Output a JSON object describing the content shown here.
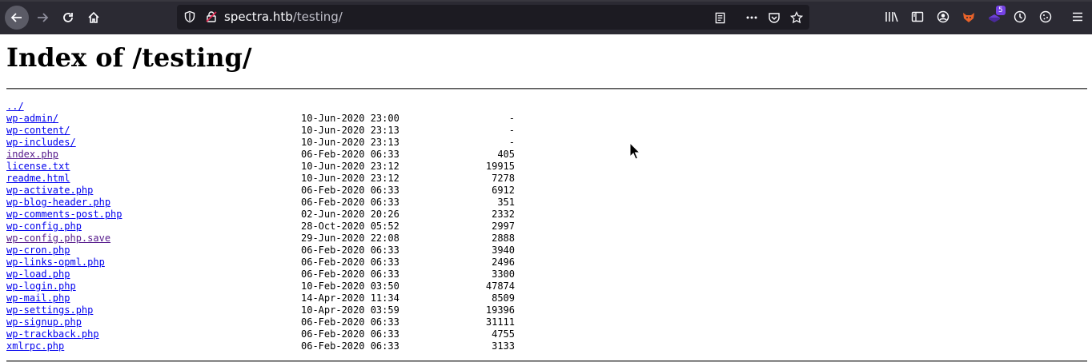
{
  "browser": {
    "url_host": "spectra.htb",
    "url_path": "/testing/",
    "extension_badge": "5"
  },
  "page": {
    "title": "Index of /testing/",
    "entries": [
      {
        "name": "../",
        "date": "",
        "size": "",
        "visited": false
      },
      {
        "name": "wp-admin/",
        "date": "10-Jun-2020 23:00",
        "size": "-",
        "visited": false
      },
      {
        "name": "wp-content/",
        "date": "10-Jun-2020 23:13",
        "size": "-",
        "visited": false
      },
      {
        "name": "wp-includes/",
        "date": "10-Jun-2020 23:13",
        "size": "-",
        "visited": false
      },
      {
        "name": "index.php",
        "date": "06-Feb-2020 06:33",
        "size": "405",
        "visited": true
      },
      {
        "name": "license.txt",
        "date": "10-Jun-2020 23:12",
        "size": "19915",
        "visited": false
      },
      {
        "name": "readme.html",
        "date": "10-Jun-2020 23:12",
        "size": "7278",
        "visited": false
      },
      {
        "name": "wp-activate.php",
        "date": "06-Feb-2020 06:33",
        "size": "6912",
        "visited": false
      },
      {
        "name": "wp-blog-header.php",
        "date": "06-Feb-2020 06:33",
        "size": "351",
        "visited": false
      },
      {
        "name": "wp-comments-post.php",
        "date": "02-Jun-2020 20:26",
        "size": "2332",
        "visited": false
      },
      {
        "name": "wp-config.php",
        "date": "28-Oct-2020 05:52",
        "size": "2997",
        "visited": false
      },
      {
        "name": "wp-config.php.save",
        "date": "29-Jun-2020 22:08",
        "size": "2888",
        "visited": true
      },
      {
        "name": "wp-cron.php",
        "date": "06-Feb-2020 06:33",
        "size": "3940",
        "visited": false
      },
      {
        "name": "wp-links-opml.php",
        "date": "06-Feb-2020 06:33",
        "size": "2496",
        "visited": false
      },
      {
        "name": "wp-load.php",
        "date": "06-Feb-2020 06:33",
        "size": "3300",
        "visited": false
      },
      {
        "name": "wp-login.php",
        "date": "10-Feb-2020 03:50",
        "size": "47874",
        "visited": false
      },
      {
        "name": "wp-mail.php",
        "date": "14-Apr-2020 11:34",
        "size": "8509",
        "visited": false
      },
      {
        "name": "wp-settings.php",
        "date": "10-Apr-2020 03:59",
        "size": "19396",
        "visited": false
      },
      {
        "name": "wp-signup.php",
        "date": "06-Feb-2020 06:33",
        "size": "31111",
        "visited": false
      },
      {
        "name": "wp-trackback.php",
        "date": "06-Feb-2020 06:33",
        "size": "4755",
        "visited": false
      },
      {
        "name": "xmlrpc.php",
        "date": "06-Feb-2020 06:33",
        "size": "3133",
        "visited": false
      }
    ]
  },
  "icons": [
    "back-icon",
    "forward-icon",
    "reload-icon",
    "home-icon",
    "shield-icon",
    "insecure-lock-icon",
    "reader-view-icon",
    "more-icon",
    "pocket-icon",
    "bookmark-star-icon",
    "library-icon",
    "sidebar-icon",
    "account-icon",
    "foxyproxy-icon",
    "extension-icon",
    "timer-icon",
    "cookie-icon",
    "menu-icon",
    "mouse-cursor-icon"
  ],
  "colors": {
    "toolbar": "#2b2a33",
    "urlbar": "#1c1b22",
    "link": "#0000ee",
    "visited_link": "#551a8b"
  }
}
